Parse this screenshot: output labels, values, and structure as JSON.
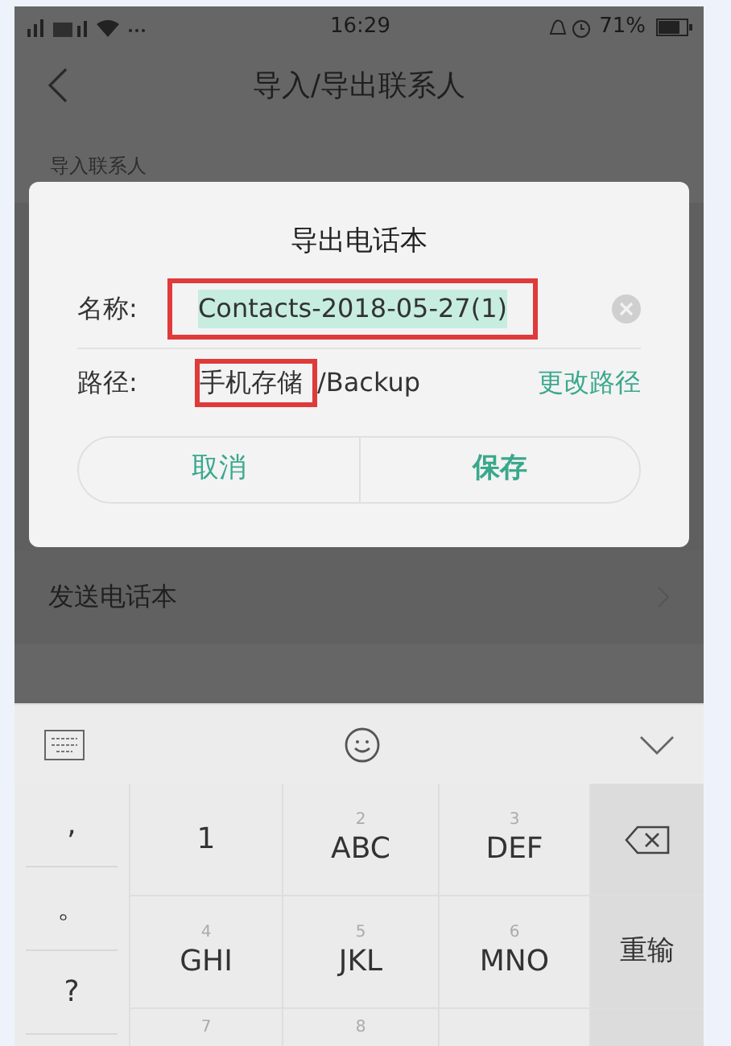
{
  "status_bar": {
    "time": "16:29",
    "battery": "71%"
  },
  "nav": {
    "title": "导入/导出联系人"
  },
  "section": {
    "label": "导入联系人"
  },
  "rows": [
    {
      "label": "发送电话本"
    }
  ],
  "dialog": {
    "title": "导出电话本",
    "name_field": {
      "label": "名称:",
      "value": "Contacts-2018-05-27(1)",
      "selected": true,
      "highlighted": true
    },
    "path": {
      "label": "路径:",
      "segments": [
        {
          "text": "手机存储",
          "highlighted": true
        },
        {
          "text": "/Backup",
          "highlighted": false
        }
      ],
      "action": "更改路径"
    },
    "buttons": [
      {
        "label": "取消",
        "primary": false
      },
      {
        "label": "保存",
        "primary": true
      }
    ]
  },
  "keyboard": {
    "punctuation": [
      ",",
      "。",
      "?"
    ],
    "keys": [
      {
        "letters": "1",
        "kind": "key"
      },
      {
        "digit": "2",
        "letters": "ABC",
        "kind": "key"
      },
      {
        "digit": "3",
        "letters": "DEF",
        "kind": "key"
      },
      {
        "kind": "backspace"
      },
      {
        "digit": "4",
        "letters": "GHI",
        "kind": "key"
      },
      {
        "digit": "5",
        "letters": "JKL",
        "kind": "key"
      },
      {
        "digit": "6",
        "letters": "MNO",
        "kind": "key"
      },
      {
        "kind": "action",
        "letters": "重输"
      },
      {
        "digit": "7",
        "kind": "key"
      },
      {
        "digit": "8",
        "kind": "key"
      },
      {
        "kind": "blank"
      },
      {
        "kind": "blank_action"
      }
    ]
  }
}
